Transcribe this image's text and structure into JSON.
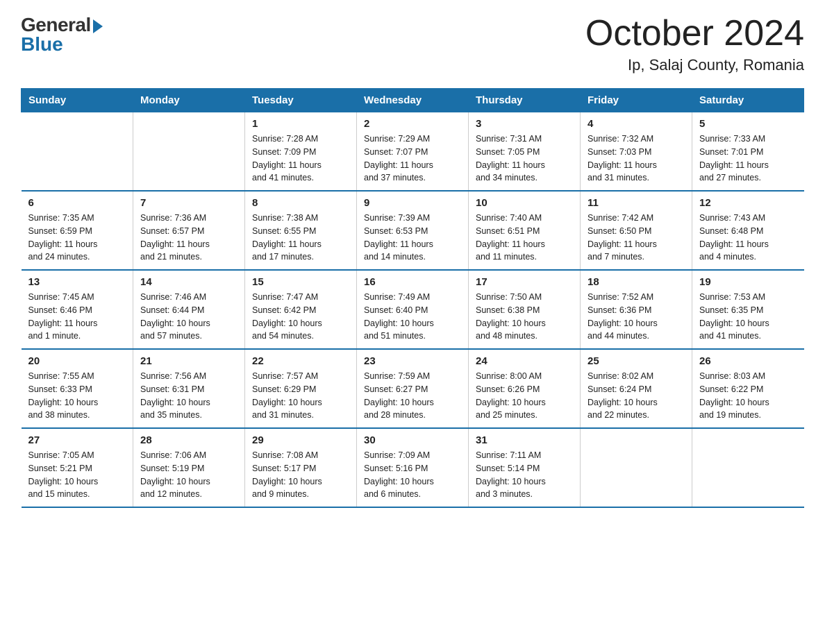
{
  "logo": {
    "general": "General",
    "blue": "Blue"
  },
  "title": "October 2024",
  "subtitle": "Ip, Salaj County, Romania",
  "headers": [
    "Sunday",
    "Monday",
    "Tuesday",
    "Wednesday",
    "Thursday",
    "Friday",
    "Saturday"
  ],
  "weeks": [
    [
      {
        "day": "",
        "info": ""
      },
      {
        "day": "",
        "info": ""
      },
      {
        "day": "1",
        "info": "Sunrise: 7:28 AM\nSunset: 7:09 PM\nDaylight: 11 hours\nand 41 minutes."
      },
      {
        "day": "2",
        "info": "Sunrise: 7:29 AM\nSunset: 7:07 PM\nDaylight: 11 hours\nand 37 minutes."
      },
      {
        "day": "3",
        "info": "Sunrise: 7:31 AM\nSunset: 7:05 PM\nDaylight: 11 hours\nand 34 minutes."
      },
      {
        "day": "4",
        "info": "Sunrise: 7:32 AM\nSunset: 7:03 PM\nDaylight: 11 hours\nand 31 minutes."
      },
      {
        "day": "5",
        "info": "Sunrise: 7:33 AM\nSunset: 7:01 PM\nDaylight: 11 hours\nand 27 minutes."
      }
    ],
    [
      {
        "day": "6",
        "info": "Sunrise: 7:35 AM\nSunset: 6:59 PM\nDaylight: 11 hours\nand 24 minutes."
      },
      {
        "day": "7",
        "info": "Sunrise: 7:36 AM\nSunset: 6:57 PM\nDaylight: 11 hours\nand 21 minutes."
      },
      {
        "day": "8",
        "info": "Sunrise: 7:38 AM\nSunset: 6:55 PM\nDaylight: 11 hours\nand 17 minutes."
      },
      {
        "day": "9",
        "info": "Sunrise: 7:39 AM\nSunset: 6:53 PM\nDaylight: 11 hours\nand 14 minutes."
      },
      {
        "day": "10",
        "info": "Sunrise: 7:40 AM\nSunset: 6:51 PM\nDaylight: 11 hours\nand 11 minutes."
      },
      {
        "day": "11",
        "info": "Sunrise: 7:42 AM\nSunset: 6:50 PM\nDaylight: 11 hours\nand 7 minutes."
      },
      {
        "day": "12",
        "info": "Sunrise: 7:43 AM\nSunset: 6:48 PM\nDaylight: 11 hours\nand 4 minutes."
      }
    ],
    [
      {
        "day": "13",
        "info": "Sunrise: 7:45 AM\nSunset: 6:46 PM\nDaylight: 11 hours\nand 1 minute."
      },
      {
        "day": "14",
        "info": "Sunrise: 7:46 AM\nSunset: 6:44 PM\nDaylight: 10 hours\nand 57 minutes."
      },
      {
        "day": "15",
        "info": "Sunrise: 7:47 AM\nSunset: 6:42 PM\nDaylight: 10 hours\nand 54 minutes."
      },
      {
        "day": "16",
        "info": "Sunrise: 7:49 AM\nSunset: 6:40 PM\nDaylight: 10 hours\nand 51 minutes."
      },
      {
        "day": "17",
        "info": "Sunrise: 7:50 AM\nSunset: 6:38 PM\nDaylight: 10 hours\nand 48 minutes."
      },
      {
        "day": "18",
        "info": "Sunrise: 7:52 AM\nSunset: 6:36 PM\nDaylight: 10 hours\nand 44 minutes."
      },
      {
        "day": "19",
        "info": "Sunrise: 7:53 AM\nSunset: 6:35 PM\nDaylight: 10 hours\nand 41 minutes."
      }
    ],
    [
      {
        "day": "20",
        "info": "Sunrise: 7:55 AM\nSunset: 6:33 PM\nDaylight: 10 hours\nand 38 minutes."
      },
      {
        "day": "21",
        "info": "Sunrise: 7:56 AM\nSunset: 6:31 PM\nDaylight: 10 hours\nand 35 minutes."
      },
      {
        "day": "22",
        "info": "Sunrise: 7:57 AM\nSunset: 6:29 PM\nDaylight: 10 hours\nand 31 minutes."
      },
      {
        "day": "23",
        "info": "Sunrise: 7:59 AM\nSunset: 6:27 PM\nDaylight: 10 hours\nand 28 minutes."
      },
      {
        "day": "24",
        "info": "Sunrise: 8:00 AM\nSunset: 6:26 PM\nDaylight: 10 hours\nand 25 minutes."
      },
      {
        "day": "25",
        "info": "Sunrise: 8:02 AM\nSunset: 6:24 PM\nDaylight: 10 hours\nand 22 minutes."
      },
      {
        "day": "26",
        "info": "Sunrise: 8:03 AM\nSunset: 6:22 PM\nDaylight: 10 hours\nand 19 minutes."
      }
    ],
    [
      {
        "day": "27",
        "info": "Sunrise: 7:05 AM\nSunset: 5:21 PM\nDaylight: 10 hours\nand 15 minutes."
      },
      {
        "day": "28",
        "info": "Sunrise: 7:06 AM\nSunset: 5:19 PM\nDaylight: 10 hours\nand 12 minutes."
      },
      {
        "day": "29",
        "info": "Sunrise: 7:08 AM\nSunset: 5:17 PM\nDaylight: 10 hours\nand 9 minutes."
      },
      {
        "day": "30",
        "info": "Sunrise: 7:09 AM\nSunset: 5:16 PM\nDaylight: 10 hours\nand 6 minutes."
      },
      {
        "day": "31",
        "info": "Sunrise: 7:11 AM\nSunset: 5:14 PM\nDaylight: 10 hours\nand 3 minutes."
      },
      {
        "day": "",
        "info": ""
      },
      {
        "day": "",
        "info": ""
      }
    ]
  ]
}
